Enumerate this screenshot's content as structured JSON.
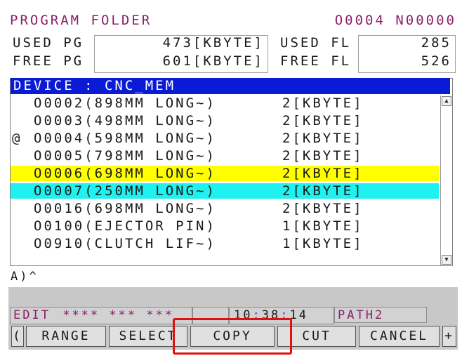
{
  "header": {
    "title": "PROGRAM FOLDER",
    "program_id": "O0004 N00000"
  },
  "memory": {
    "used_pg_label": "USED PG",
    "used_pg_value": "473[KBYTE]",
    "free_pg_label": "FREE PG",
    "free_pg_value": "601[KBYTE]",
    "used_fl_label": "USED FL",
    "used_fl_value": "285",
    "free_fl_label": "FREE FL",
    "free_fl_value": "526"
  },
  "device": "DEVICE : CNC_MEM",
  "programs": [
    {
      "mark": "",
      "name": "O0002(898MM LONG~)",
      "size": "2[KBYTE]",
      "state": "normal"
    },
    {
      "mark": "",
      "name": "O0003(498MM LONG~)",
      "size": "2[KBYTE]",
      "state": "normal"
    },
    {
      "mark": "@",
      "name": "O0004(598MM LONG~)",
      "size": "2[KBYTE]",
      "state": "current"
    },
    {
      "mark": "",
      "name": "O0005(798MM LONG~)",
      "size": "2[KBYTE]",
      "state": "normal"
    },
    {
      "mark": "",
      "name": "O0006(698MM LONG~)",
      "size": "2[KBYTE]",
      "state": "selected-yellow"
    },
    {
      "mark": "",
      "name": "O0007(250MM LONG~)",
      "size": "2[KBYTE]",
      "state": "selected-cyan"
    },
    {
      "mark": "",
      "name": "O0016(698MM LONG~)",
      "size": "2[KBYTE]",
      "state": "normal"
    },
    {
      "mark": "",
      "name": "O0100(EJECTOR PIN)",
      "size": "1[KBYTE]",
      "state": "normal"
    },
    {
      "mark": "",
      "name": "O0910(CLUTCH LIF~)",
      "size": "1[KBYTE]",
      "state": "normal"
    }
  ],
  "input_prompt": "A)^",
  "status": {
    "mode": "EDIT",
    "stars": "**** ***  ***",
    "time_h": "10",
    "time_m": "38",
    "time_s": "14",
    "path": "PATH2"
  },
  "softkeys": {
    "left_arrow": "(",
    "range": "RANGE",
    "select": "SELECT",
    "copy": "COPY",
    "cut": "CUT",
    "cancel": "CANCEL",
    "right_plus": "+"
  },
  "colors": {
    "title": "#8a1f6a",
    "device_bar": "#0a1bd6",
    "row_yellow": "#ffff00",
    "row_cyan": "#1ff0f0",
    "highlight": "#e01010"
  }
}
